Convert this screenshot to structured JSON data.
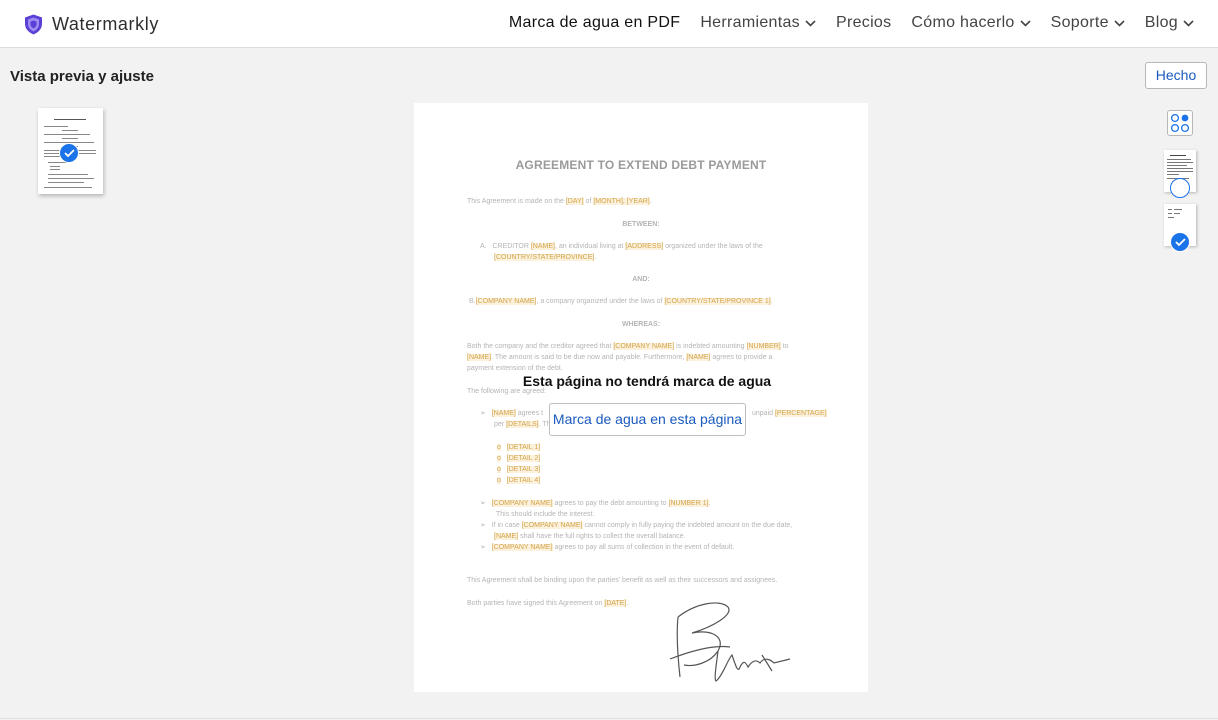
{
  "app": {
    "name": "Watermarkly"
  },
  "nav": {
    "items": [
      {
        "label": "Marca de agua en PDF",
        "dropdown": false,
        "active": true
      },
      {
        "label": "Herramientas",
        "dropdown": true
      },
      {
        "label": "Precios",
        "dropdown": false
      },
      {
        "label": "Cómo hacerlo",
        "dropdown": true
      },
      {
        "label": "Soporte",
        "dropdown": true
      },
      {
        "label": "Blog",
        "dropdown": true
      }
    ]
  },
  "page": {
    "heading": "Vista previa y ajuste",
    "done_label": "Hecho"
  },
  "document": {
    "title": "AGREEMENT TO EXTEND DEBT PAYMENT",
    "line1": {
      "a": "This Agreement is made on the ",
      "day": "[DAY]",
      "b": " of ",
      "month": "[MONTH], [YEAR]",
      "c": "."
    },
    "between": "BETWEEN:",
    "creditor": {
      "num": "A.",
      "a": "CREDITOR ",
      "name": "[NAME]",
      "b": ", an individual      living at     ",
      "address": "[ADDRESS]",
      "c": " organized under      the  laws of      the"
    },
    "creditor2": "[COUNTRY/STATE/PROVINCE]",
    "and": "AND:",
    "company": {
      "a": "B.",
      "name": "[COMPANY NAME]",
      "b": ", a company organized under the laws of ",
      "country": "[COUNTRY/STATE/PROVINCE 1]",
      "c": "."
    },
    "whereas": "WHEREAS:",
    "para1": {
      "a": "Both the company and the creditor agreed that ",
      "company": "[COMPANY NAME]",
      "b": " is indebted amounting ",
      "number": "[NUMBER]",
      "c": " to"
    },
    "para2": {
      "name": "[NAME]",
      "a": ". The amount is said to be due now and payable. Furthermore, ",
      "name2": "[NAME]",
      "b": " agrees to provide a"
    },
    "para3": "payment extension of the debt.",
    "following": "The following are agreed:",
    "bullet1": {
      "name": "[NAME]",
      "a": " agrees t",
      "b": "unpaid ",
      "pct": "[PERCENTAGE]"
    },
    "bullet1b": {
      "a": "per ",
      "details": "[DETAILS]",
      "b": ". Th"
    },
    "details": [
      "[DETAIL 1]",
      "[DETAIL 2]",
      "[DETAIL 3]",
      "[DETAIL 4]"
    ],
    "bullet2": {
      "company": "[COMPANY NAME]",
      "a": " agrees to pay the debt amounting to ",
      "number": "[NUMBER 1]",
      "b": "."
    },
    "bullet2b": "This should include the interest.",
    "bullet3": {
      "a": "If in case ",
      "company": "[COMPANY NAME]",
      "b": " cannot comply in fully paying the indebted amount on the due date,"
    },
    "bullet3b": {
      "name": "[NAME]",
      "a": " shall have the full rights to collect the overall balance."
    },
    "bullet4": {
      "company": "[COMPANY NAME]",
      "a": " agrees to pay all sums of collection in the event of default."
    },
    "binding": "This Agreement shall be binding upon the parties' benefit as well as their successors and assignees.",
    "signed": {
      "a": "Both parties have signed this Agreement on ",
      "date": "[DATE]",
      "b": "."
    }
  },
  "overlay": {
    "message": "Esta página no tendrá marca de agua",
    "button": "Marca de agua en esta página"
  },
  "colors": {
    "accent": "#1a73e8",
    "link": "#1a5bbf",
    "placeholder_bg": "#fbf1dc",
    "placeholder_text": "#d4a44b"
  }
}
